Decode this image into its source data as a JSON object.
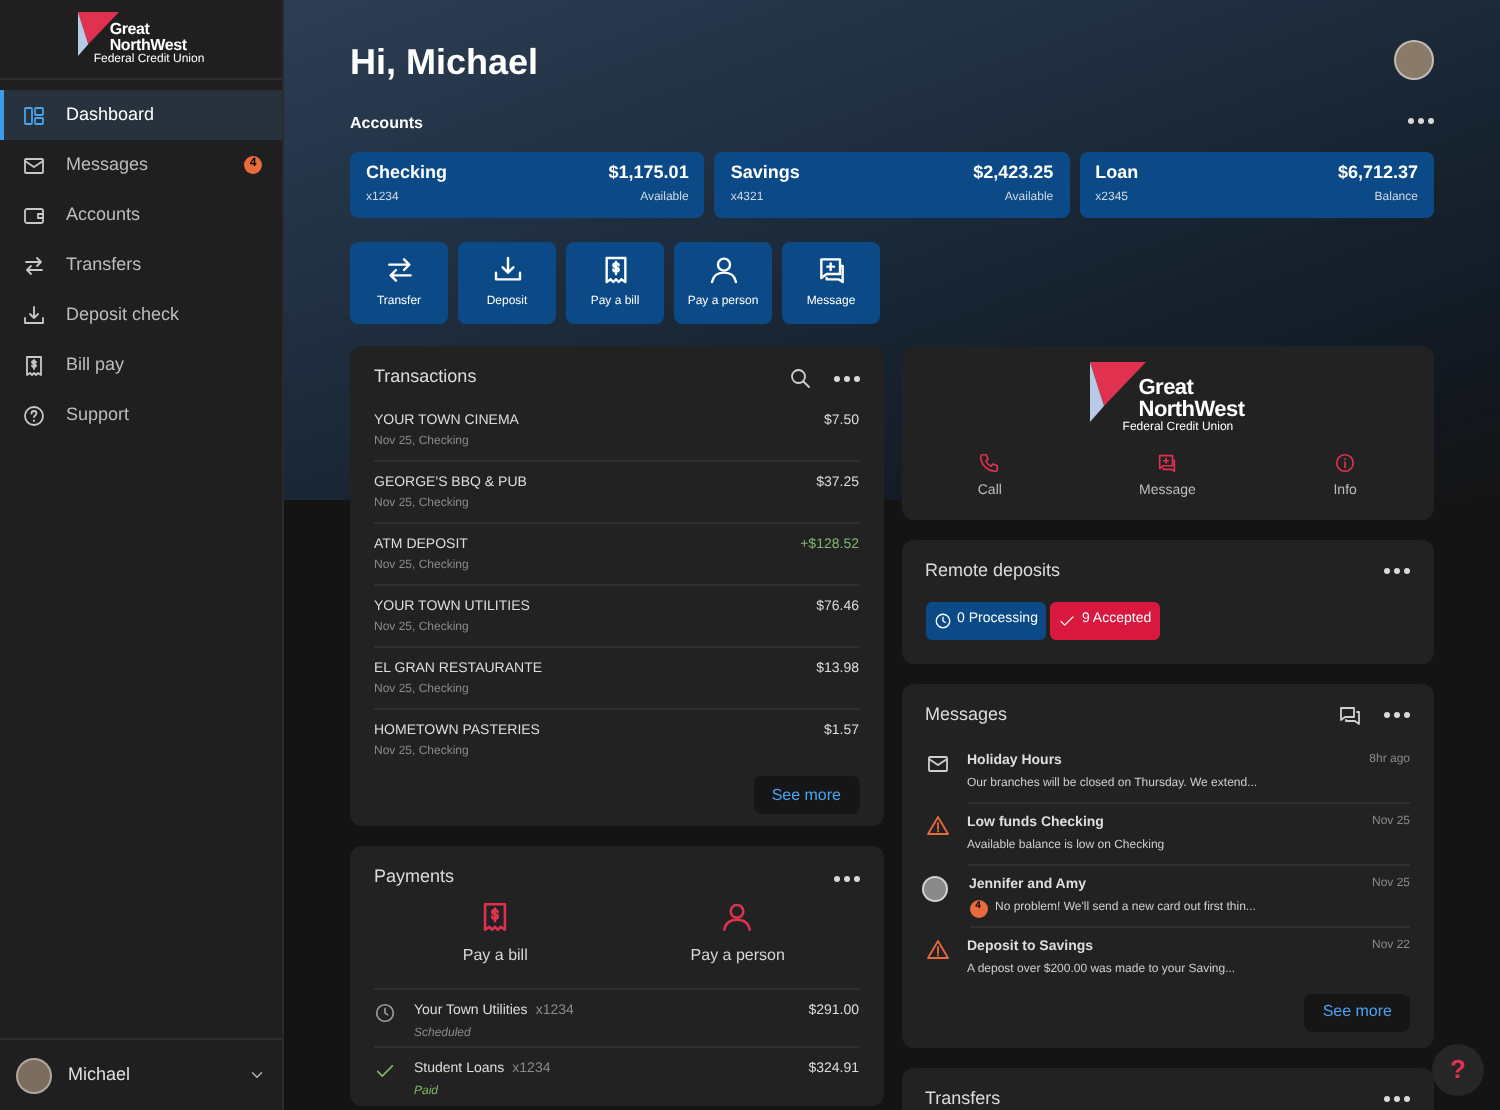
{
  "sidebar": {
    "logo": {
      "line1": "Great",
      "line2": "NorthWest",
      "subtitle": "Federal Credit Union"
    },
    "items": [
      {
        "label": "Dashboard",
        "kind": "dashboard",
        "selected": true
      },
      {
        "label": "Messages",
        "kind": "mail",
        "selected": false,
        "badge": "4"
      },
      {
        "label": "Accounts",
        "kind": "wallet",
        "selected": false
      },
      {
        "label": "Transfers",
        "kind": "transfer",
        "selected": false
      },
      {
        "label": "Deposit check",
        "kind": "deposit",
        "selected": false
      },
      {
        "label": "Bill pay",
        "kind": "bill",
        "selected": false
      },
      {
        "label": "Support",
        "kind": "help",
        "selected": false
      }
    ],
    "user": {
      "name": "Michael"
    }
  },
  "header": {
    "greeting": "Hi, Michael",
    "section_label": "Accounts"
  },
  "accounts": [
    {
      "name": "Checking",
      "number": "x1234",
      "amount": "$1,175.01",
      "caption": "Available"
    },
    {
      "name": "Savings",
      "number": "x4321",
      "amount": "$2,423.25",
      "caption": "Available"
    },
    {
      "name": "Loan",
      "number": "x2345",
      "amount": "$6,712.37",
      "caption": "Balance"
    }
  ],
  "actions": [
    {
      "label": "Transfer",
      "kind": "transfer"
    },
    {
      "label": "Deposit",
      "kind": "deposit"
    },
    {
      "label": "Pay a bill",
      "kind": "bill"
    },
    {
      "label": "Pay a person",
      "kind": "person"
    },
    {
      "label": "Message",
      "kind": "chatplus"
    }
  ],
  "transactions": {
    "title": "Transactions",
    "rows": [
      {
        "name": "YOUR TOWN CINEMA",
        "meta": "Nov 25, Checking",
        "amount": "$7.50",
        "kind": "debit"
      },
      {
        "name": "GEORGE'S BBQ & PUB",
        "meta": "Nov 25, Checking",
        "amount": "$37.25",
        "kind": "debit"
      },
      {
        "name": "ATM DEPOSIT",
        "meta": "Nov 25, Checking",
        "amount": "+$128.52",
        "kind": "credit"
      },
      {
        "name": "YOUR TOWN UTILITIES",
        "meta": "Nov 25, Checking",
        "amount": "$76.46",
        "kind": "debit"
      },
      {
        "name": "EL GRAN RESTAURANTE",
        "meta": "Nov 25, Checking",
        "amount": "$13.98",
        "kind": "debit"
      },
      {
        "name": "HOMETOWN PASTERIES",
        "meta": "Nov 25, Checking",
        "amount": "$1.57",
        "kind": "debit"
      }
    ],
    "see_more": "See more"
  },
  "payments": {
    "title": "Payments",
    "actions": [
      {
        "label": "Pay a bill",
        "kind": "bill"
      },
      {
        "label": "Pay a person",
        "kind": "person"
      }
    ],
    "rows": [
      {
        "payee": "Your Town Utilities",
        "account": "x1234",
        "status": "Scheduled",
        "kind": "scheduled",
        "amount": "$291.00"
      },
      {
        "payee": "Student Loans",
        "account": "x1234",
        "status": "Paid",
        "kind": "paid",
        "amount": "$324.91"
      }
    ]
  },
  "branding": {
    "logo": {
      "line1": "Great",
      "line2": "NorthWest",
      "subtitle": "Federal Credit Union"
    },
    "contacts": [
      {
        "label": "Call",
        "kind": "phone"
      },
      {
        "label": "Message",
        "kind": "chatplus"
      },
      {
        "label": "Info",
        "kind": "info"
      }
    ]
  },
  "remote_deposits": {
    "title": "Remote deposits",
    "badges": [
      {
        "label": "0 Processing",
        "kind": "processing"
      },
      {
        "label": "9 Accepted",
        "kind": "accepted"
      }
    ]
  },
  "messages": {
    "title": "Messages",
    "items": [
      {
        "title": "Holiday Hours",
        "preview": "Our branches will be closed on Thursday. We extend...",
        "time": "8hr ago",
        "kind": "mail"
      },
      {
        "title": "Low funds Checking",
        "preview": "Available balance is low on Checking",
        "time": "Nov 25",
        "kind": "alert"
      },
      {
        "title": "Jennifer and Amy",
        "preview": "No problem! We'll send a new card out first thin...",
        "time": "Nov 25",
        "kind": "chat",
        "badge": "4"
      },
      {
        "title": "Deposit to Savings",
        "preview": "A depost over $200.00 was made to your Saving...",
        "time": "Nov 22",
        "kind": "alert"
      }
    ],
    "see_more": "See more"
  },
  "transfers": {
    "title": "Transfers"
  },
  "help_button": "?"
}
